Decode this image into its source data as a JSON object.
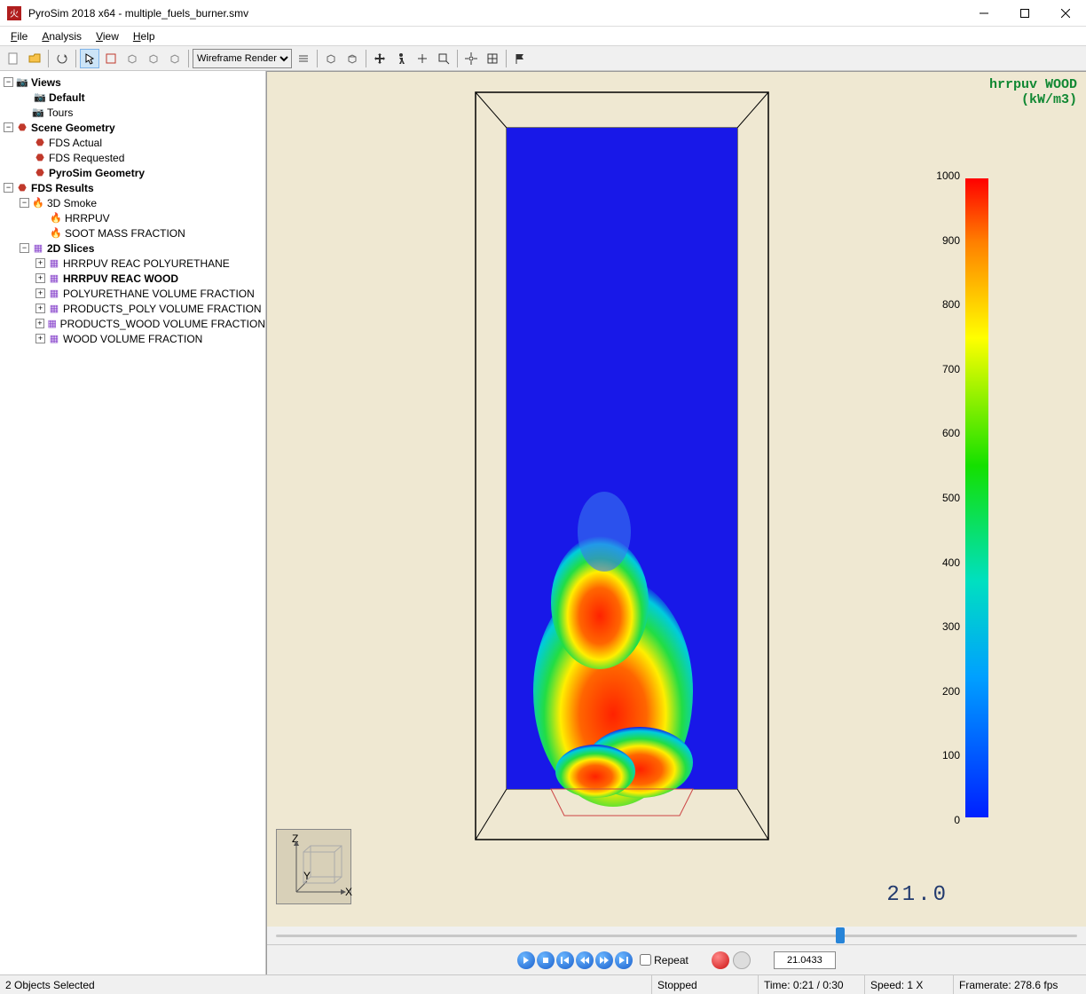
{
  "window": {
    "title": "PyroSim 2018 x64 - multiple_fuels_burner.smv"
  },
  "menu": {
    "file": "File",
    "analysis": "Analysis",
    "view": "View",
    "help": "Help"
  },
  "toolbar": {
    "render_mode": "Wireframe Render",
    "render_options": [
      "Wireframe Render"
    ]
  },
  "tree": {
    "views": "Views",
    "default": "Default",
    "tours": "Tours",
    "scene_geometry": "Scene Geometry",
    "fds_actual": "FDS Actual",
    "fds_requested": "FDS Requested",
    "pyrosim_geometry": "PyroSim Geometry",
    "fds_results": "FDS Results",
    "smoke3d": "3D Smoke",
    "hrrpuv": "HRRPUV",
    "soot": "SOOT MASS FRACTION",
    "slices2d": "2D Slices",
    "s1": "HRRPUV REAC POLYURETHANE",
    "s2": "HRRPUV REAC WOOD",
    "s3": "POLYURETHANE VOLUME FRACTION",
    "s4": "PRODUCTS_POLY VOLUME FRACTION",
    "s5": "PRODUCTS_WOOD VOLUME FRACTION",
    "s6": "WOOD VOLUME FRACTION"
  },
  "colorbar": {
    "title_line1": "hrrpuv WOOD",
    "title_line2": "(kW/m3)",
    "ticks": [
      "1000",
      "900",
      "800",
      "700",
      "600",
      "500",
      "400",
      "300",
      "200",
      "100",
      "0"
    ]
  },
  "playback": {
    "repeat_label": "Repeat",
    "time_field": "21.0433",
    "slider_pos_pct": 70
  },
  "timecode": "21.0",
  "status": {
    "selection": "2 Objects Selected",
    "state": "Stopped",
    "time": "Time: 0:21 / 0:30",
    "speed": "Speed: 1 X",
    "framerate": "Framerate: 278.6 fps"
  },
  "chart_data": {
    "type": "heatmap",
    "title": "hrrpuv WOOD (kW/m3)",
    "colorbar_range": [
      0,
      1000
    ],
    "colorbar_ticks": [
      0,
      100,
      200,
      300,
      400,
      500,
      600,
      700,
      800,
      900,
      1000
    ],
    "time_s": 21.0,
    "notes": "2D slice of heat release rate per unit volume; blue background ~0, flame region near burner with values up to ~1000 kW/m3"
  }
}
